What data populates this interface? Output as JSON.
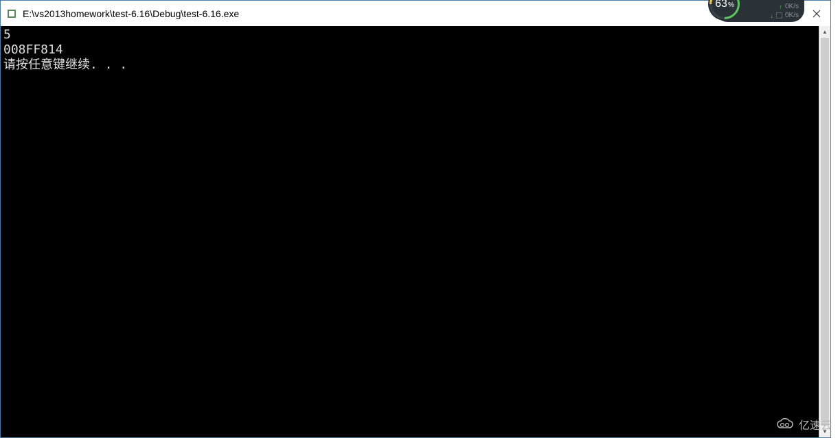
{
  "window": {
    "title": "E:\\vs2013homework\\test-6.16\\Debug\\test-6.16.exe"
  },
  "console": {
    "lines": [
      "5",
      "008FF814",
      "请按任意键继续. . ."
    ]
  },
  "network_widget": {
    "cpu_percent": "63",
    "percent_symbol": "%",
    "upload_speed": "0K/s",
    "download_speed": "0K/s"
  },
  "watermark": {
    "text": "亿速云"
  }
}
